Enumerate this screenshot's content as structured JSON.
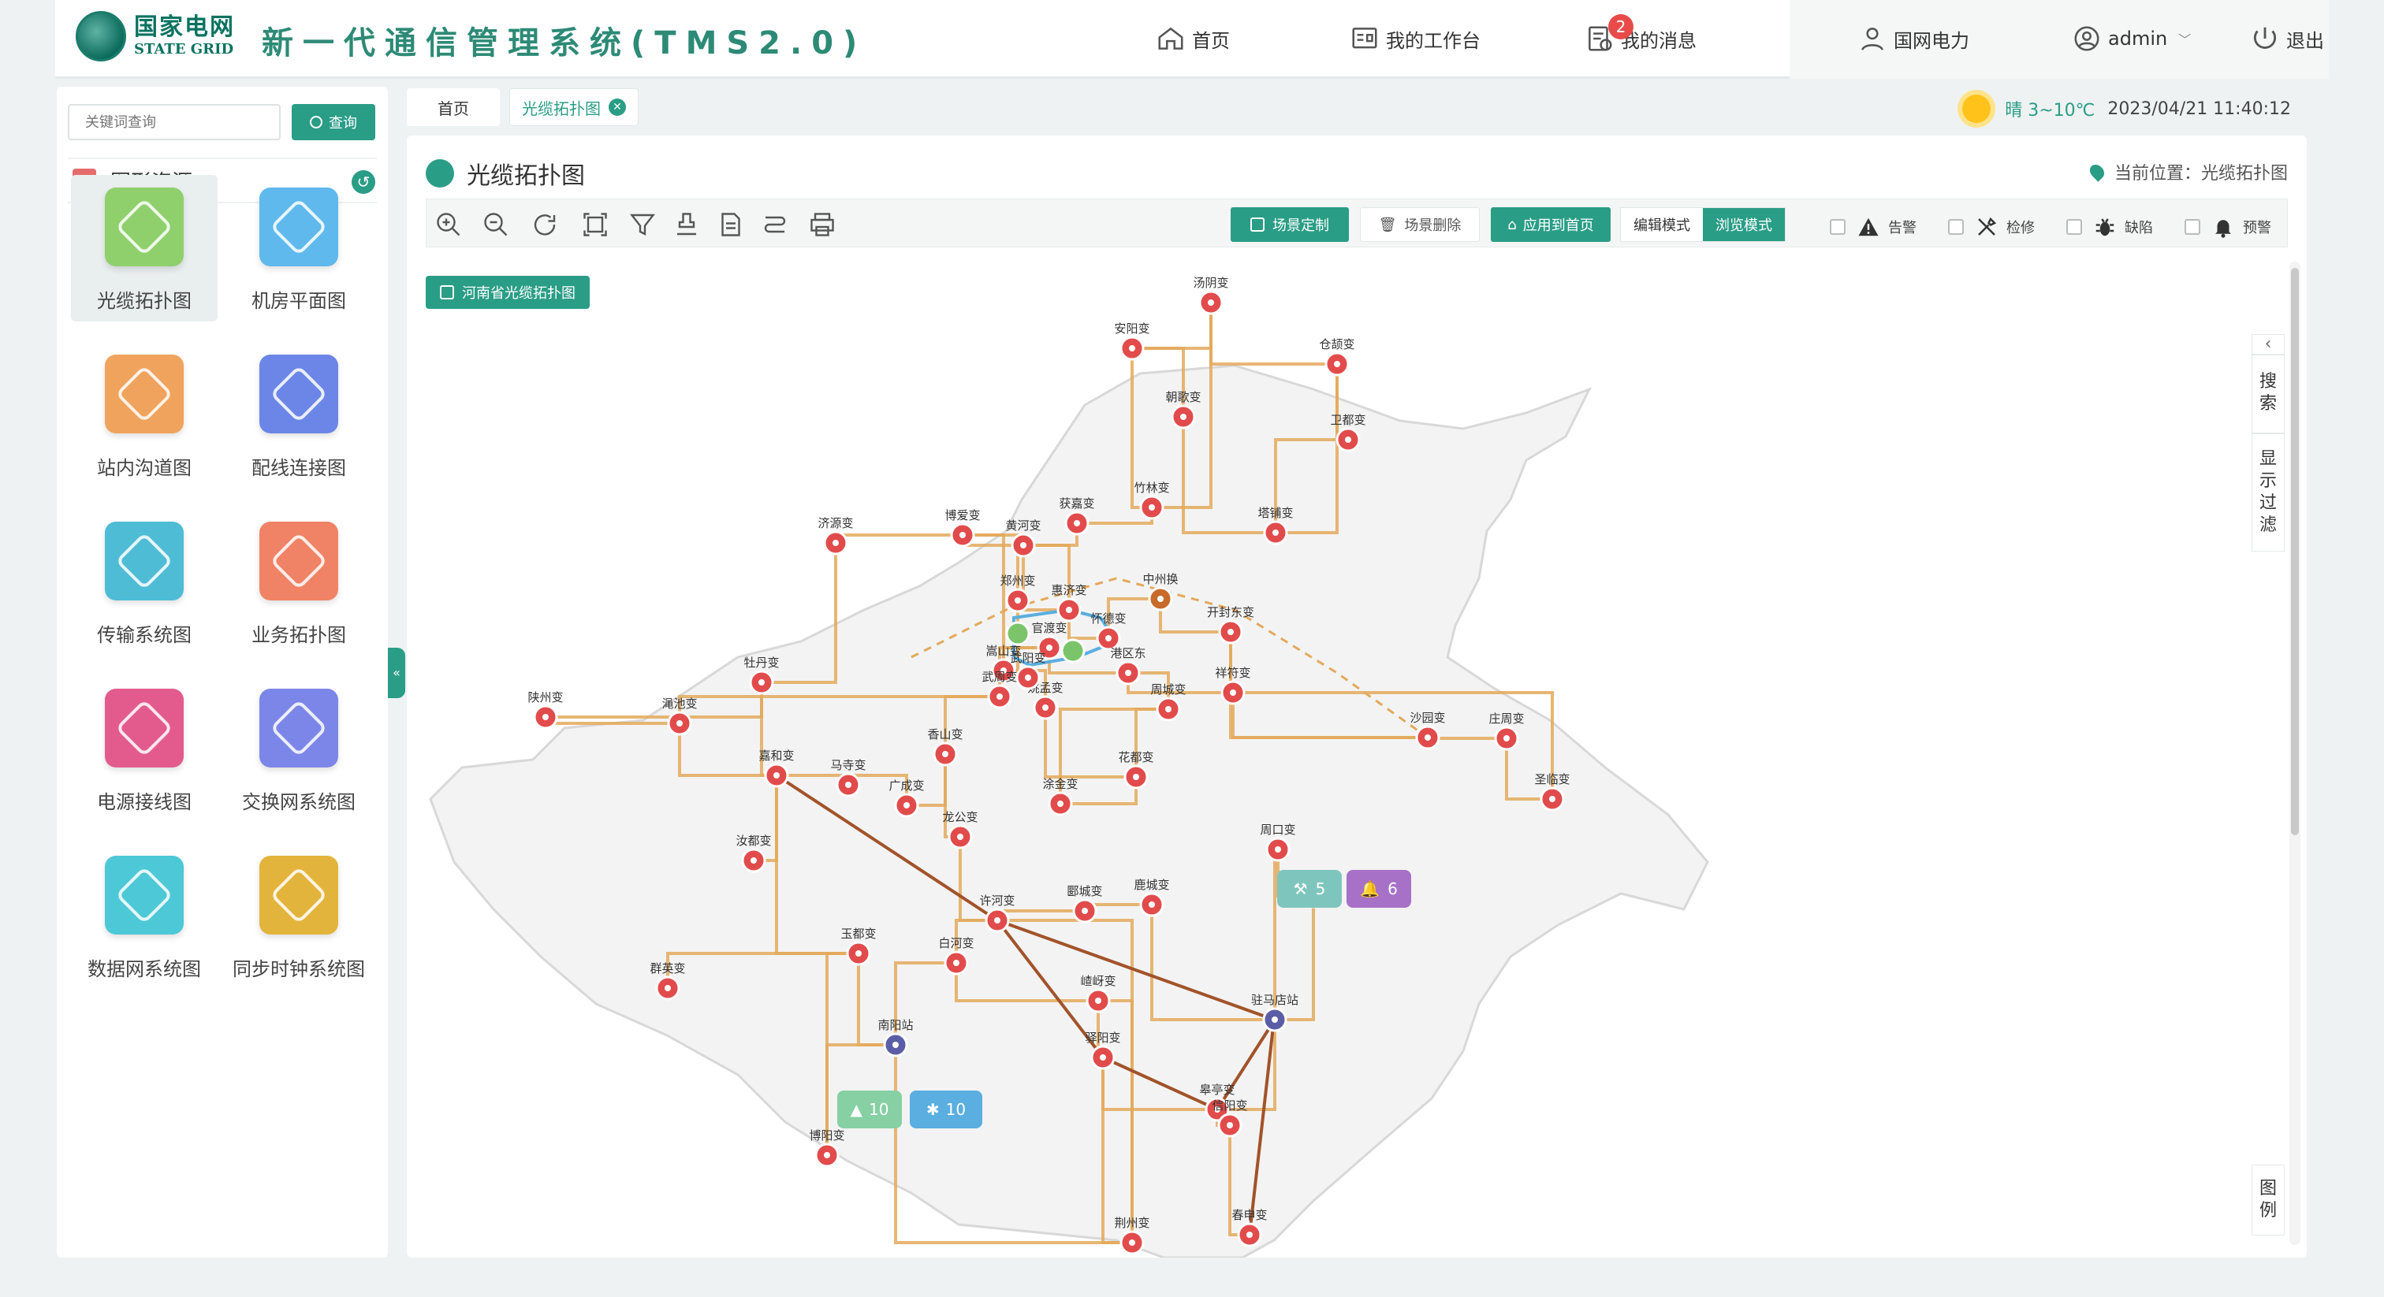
{
  "header": {
    "logo_cn": "国家电网",
    "logo_en": "STATE GRID",
    "title": "新一代通信管理系统(TMS2.0)",
    "nav": {
      "home": "首页",
      "workbench": "我的工作台",
      "messages": "我的消息",
      "messages_badge": "2",
      "org": "国网电力",
      "user": "admin",
      "logout": "退出"
    }
  },
  "sidebar": {
    "search_placeholder": "关键词查询",
    "search_button": "查询",
    "section_title": "图形资源",
    "items": [
      {
        "label": "光缆拓扑图",
        "color": "#8fd06d",
        "icon": "topology-icon"
      },
      {
        "label": "机房平面图",
        "color": "#5fb9ec",
        "icon": "building-icon"
      },
      {
        "label": "站内沟道图",
        "color": "#f0a35c",
        "icon": "channel-icon"
      },
      {
        "label": "配线连接图",
        "color": "#6b86e6",
        "icon": "wiring-icon"
      },
      {
        "label": "传输系统图",
        "color": "#4fbcd6",
        "icon": "transmission-icon"
      },
      {
        "label": "业务拓扑图",
        "color": "#f08365",
        "icon": "briefcase-icon"
      },
      {
        "label": "电源接线图",
        "color": "#e35b8c",
        "icon": "power-icon"
      },
      {
        "label": "交换网系统图",
        "color": "#7c86e8",
        "icon": "switch-icon"
      },
      {
        "label": "数据网系统图",
        "color": "#4dc8d6",
        "icon": "database-icon"
      },
      {
        "label": "同步时钟系统图",
        "color": "#e3b43c",
        "icon": "clock-icon"
      }
    ]
  },
  "tabs": [
    {
      "label": "首页"
    },
    {
      "label": "光缆拓扑图"
    }
  ],
  "weather": {
    "text": "晴 3~10℃",
    "datetime": "2023/04/21 11:40:12"
  },
  "main": {
    "title": "光缆拓扑图",
    "location": "当前位置：光缆拓扑图",
    "toolbar": {
      "scene_custom": "场景定制",
      "scene_delete": "场景删除",
      "apply_home": "应用到首页",
      "edit_mode": "编辑模式",
      "browse_mode": "浏览模式",
      "filters": [
        "告警",
        "检修",
        "缺陷",
        "预警"
      ]
    },
    "map_button": "河南省光缆拓扑图",
    "dock": {
      "search": "搜索",
      "filter": "显示过滤",
      "legend": "图例"
    },
    "bubbles": {
      "maint": "5",
      "warn": "6",
      "alarm": "10",
      "defect": "10"
    }
  },
  "stations": [
    {
      "name": "汤阴变"
    },
    {
      "name": "安阳变"
    },
    {
      "name": "仓颉变"
    },
    {
      "name": "朝歌变"
    },
    {
      "name": "卫都变"
    },
    {
      "name": "竹林变"
    },
    {
      "name": "获嘉变"
    },
    {
      "name": "博爱变"
    },
    {
      "name": "塔铺变"
    },
    {
      "name": "济源变"
    },
    {
      "name": "黄河变"
    },
    {
      "name": "郑州变"
    },
    {
      "name": "惠济变"
    },
    {
      "name": "中州换"
    },
    {
      "name": "开封东变"
    },
    {
      "name": "怀德变"
    },
    {
      "name": "官渡变"
    },
    {
      "name": "嵩山变"
    },
    {
      "name": "港区东"
    },
    {
      "name": "祥符变"
    },
    {
      "name": "牡丹变"
    },
    {
      "name": "陕州变"
    },
    {
      "name": "渑池变"
    },
    {
      "name": "武周变"
    },
    {
      "name": "周城变"
    },
    {
      "name": "姚孟变"
    },
    {
      "name": "嘉和变"
    },
    {
      "name": "香山变"
    },
    {
      "name": "花都变"
    },
    {
      "name": "沙园变"
    },
    {
      "name": "庄周变"
    },
    {
      "name": "圣临变"
    },
    {
      "name": "广成变"
    },
    {
      "name": "涂金变"
    },
    {
      "name": "龙公变"
    },
    {
      "name": "汝都变"
    },
    {
      "name": "周口变"
    },
    {
      "name": "许河变"
    },
    {
      "name": "新蔡变"
    },
    {
      "name": "郾城变"
    },
    {
      "name": "鹿城变"
    },
    {
      "name": "玉都变"
    },
    {
      "name": "白河变"
    },
    {
      "name": "群英变"
    },
    {
      "name": "嵖岈变"
    },
    {
      "name": "南阳站"
    },
    {
      "name": "驿阳变"
    },
    {
      "name": "驻马店站"
    },
    {
      "name": "皋亭变"
    },
    {
      "name": "信阳变"
    },
    {
      "name": "博阳变"
    },
    {
      "name": "春申变"
    },
    {
      "name": "荆州变"
    },
    {
      "name": "马寺变"
    },
    {
      "name": "武阳变"
    }
  ],
  "colors": {
    "accent": "#2a9d86",
    "station": "#e24b4b",
    "line": "#e3a95c",
    "line_dark": "#a2532a",
    "line_blue": "#5aaee0"
  }
}
